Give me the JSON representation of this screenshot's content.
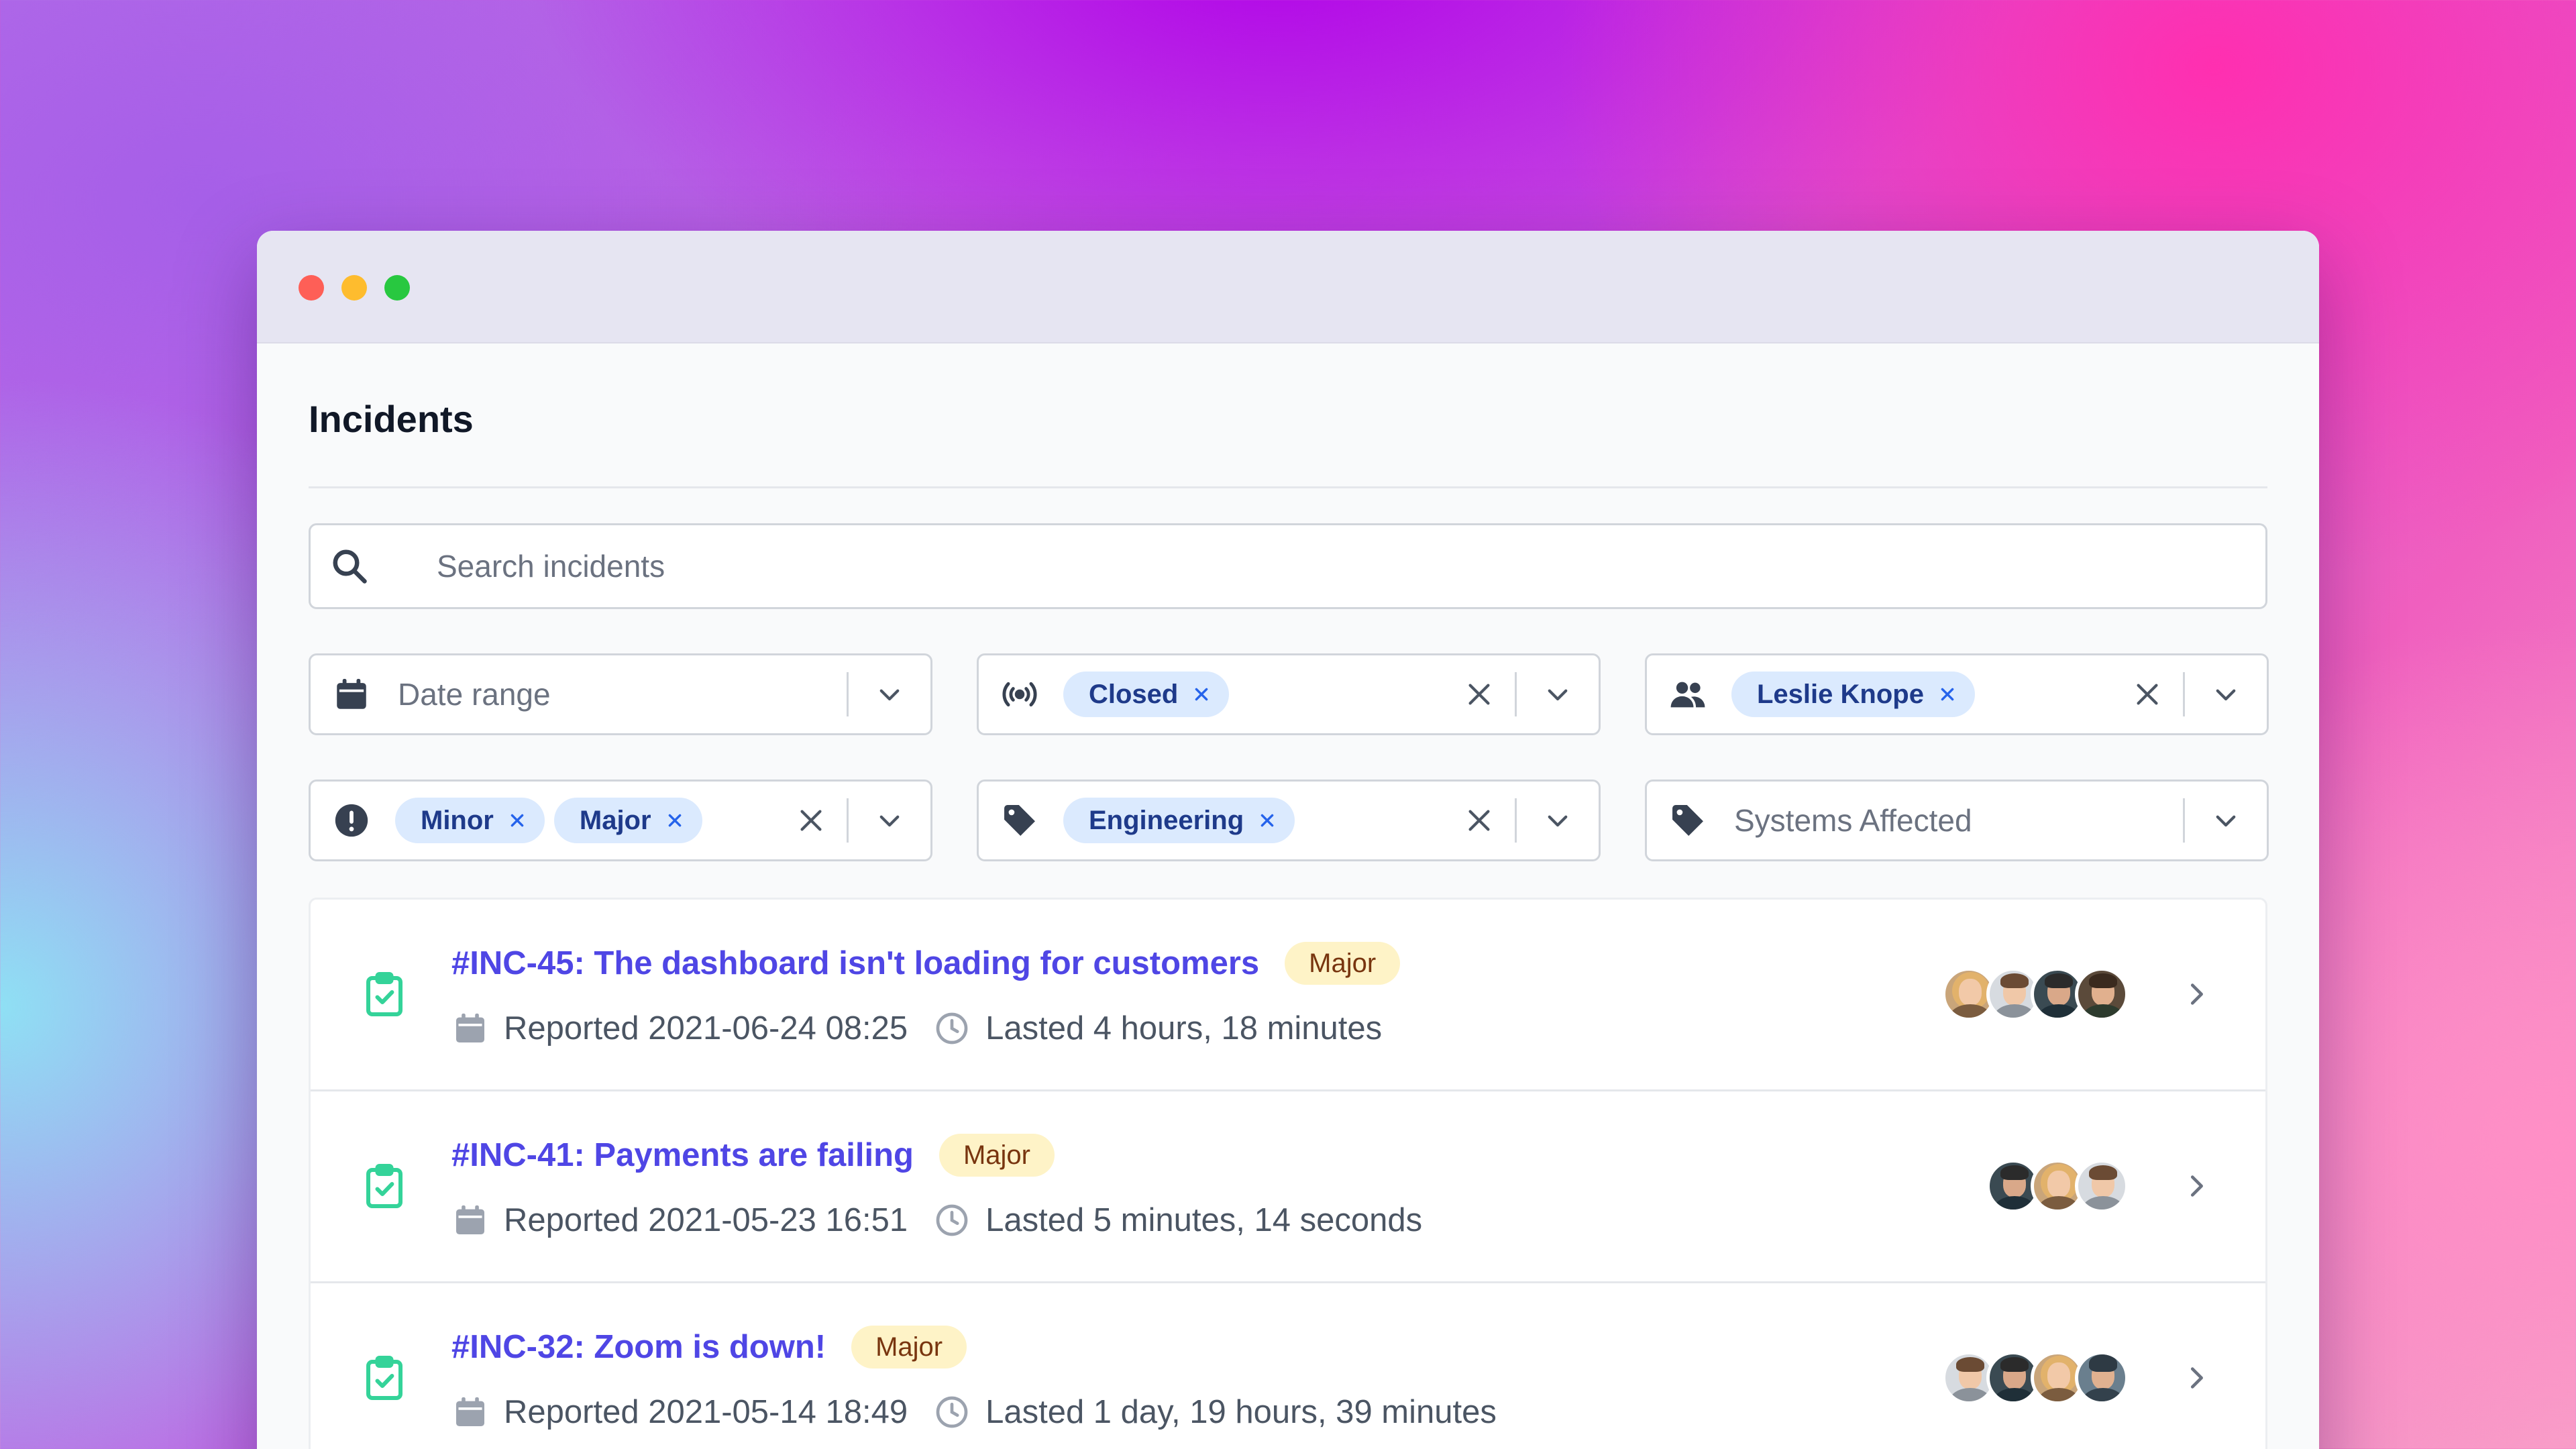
{
  "window": {
    "controls": [
      "close",
      "minimize",
      "zoom"
    ]
  },
  "page": {
    "title": "Incidents"
  },
  "search": {
    "placeholder": "Search incidents",
    "value": "",
    "icon": "search-icon"
  },
  "filters": {
    "date_range": {
      "placeholder": "Date range",
      "icon": "calendar-icon"
    },
    "status": {
      "icon": "broadcast-icon",
      "chips": [
        "Closed"
      ]
    },
    "people": {
      "icon": "users-icon",
      "chips": [
        "Leslie Knope"
      ]
    },
    "severity": {
      "icon": "exclamation-circle-icon",
      "chips": [
        "Minor",
        "Major"
      ]
    },
    "team": {
      "icon": "tag-icon",
      "chips": [
        "Engineering"
      ]
    },
    "systems": {
      "placeholder": "Systems Affected",
      "icon": "tag-icon"
    }
  },
  "colors": {
    "accent": "#4f46e5",
    "chip_bg": "#dbeafe",
    "chip_text": "#1e3a8a",
    "badge_bg": "#fef3c7",
    "badge_text": "#78350f",
    "status_green": "#34d399"
  },
  "incidents": [
    {
      "title": "#INC-45: The dashboard isn't loading for customers",
      "severity": "Major",
      "reported": "Reported 2021-06-24 08:25",
      "lasted": "Lasted 4 hours, 18 minutes",
      "avatars": [
        "avatar-blonde-woman",
        "avatar-man-light",
        "avatar-man-bearded",
        "avatar-man-mustache"
      ]
    },
    {
      "title": "#INC-41: Payments are failing",
      "severity": "Major",
      "reported": "Reported 2021-05-23 16:51",
      "lasted": "Lasted 5 minutes, 14 seconds",
      "avatars": [
        "avatar-man-bearded",
        "avatar-blonde-woman",
        "avatar-man-light"
      ]
    },
    {
      "title": "#INC-32: Zoom is down!",
      "severity": "Major",
      "reported": "Reported 2021-05-14 18:49",
      "lasted": "Lasted 1 day, 19 hours, 39 minutes",
      "avatars": [
        "avatar-man-light",
        "avatar-man-bearded",
        "avatar-blonde-woman",
        "avatar-man-beanie"
      ]
    }
  ]
}
